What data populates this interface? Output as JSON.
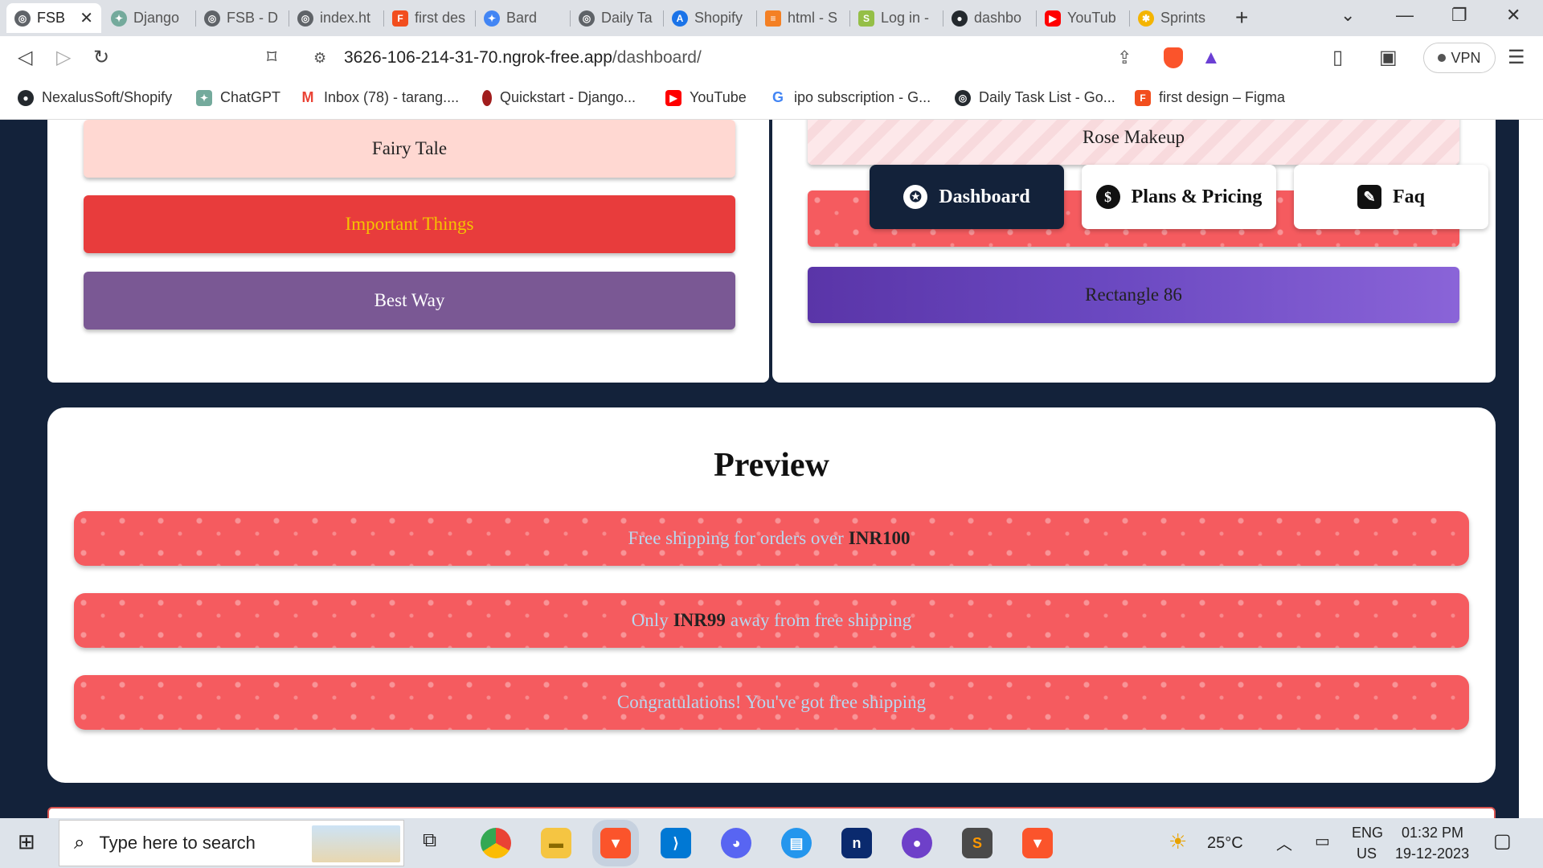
{
  "browser": {
    "tabs": [
      {
        "label": "FSB",
        "color": "#5f6368",
        "active": true
      },
      {
        "label": "Django",
        "color": "#74aa9c"
      },
      {
        "label": "FSB - D",
        "color": "#5f6368"
      },
      {
        "label": "index.ht",
        "color": "#5f6368"
      },
      {
        "label": "first des",
        "color": "#f24e1e"
      },
      {
        "label": "Bard",
        "color": "#4285f4"
      },
      {
        "label": "Daily Ta",
        "color": "#5f6368"
      },
      {
        "label": "Shopify",
        "color": "#1a73e8"
      },
      {
        "label": "html - S",
        "color": "#f48024"
      },
      {
        "label": "Log in -",
        "color": "#95bf47"
      },
      {
        "label": "dashbo",
        "color": "#24292e"
      },
      {
        "label": "YouTub",
        "color": "#ff0000"
      },
      {
        "label": "Sprints",
        "color": "#f4b400"
      }
    ],
    "url_host": "3626-106-214-31-70.ngrok-free.app",
    "url_path": "/dashboard/",
    "vpn_label": "VPN",
    "bookmarks": [
      {
        "label": "NexalusSoft/Shopify",
        "color": "#24292e"
      },
      {
        "label": "ChatGPT",
        "color": "#74aa9c"
      },
      {
        "label": "Inbox (78) - tarang....",
        "color": "#ea4335"
      },
      {
        "label": "Quickstart - Django...",
        "color": "#a11d1d"
      },
      {
        "label": "YouTube",
        "color": "#ff0000"
      },
      {
        "label": "ipo subscription - G...",
        "color": "#4285f4"
      },
      {
        "label": "Daily Task List - Go...",
        "color": "#24292e"
      },
      {
        "label": "first design – Figma",
        "color": "#f24e1e"
      }
    ]
  },
  "left_buttons": [
    {
      "label": "Fairy Tale",
      "bg": "#ffd8d2",
      "fg": "#222"
    },
    {
      "label": "Important Things",
      "bg": "#e83c3c",
      "fg": "#f5c400"
    },
    {
      "label": "Best Way",
      "bg": "#7a5894",
      "fg": "#ffffff"
    }
  ],
  "right_buttons": [
    {
      "label": "Rose Makeup"
    },
    {
      "label": ""
    },
    {
      "label": "Rectangle 86"
    }
  ],
  "nav": {
    "dashboard": "Dashboard",
    "plans": "Plans & Pricing",
    "faq": "Faq"
  },
  "preview": {
    "title": "Preview",
    "bar1": {
      "pre": "Free shipping for orders over",
      "bold": "INR100",
      "post": ""
    },
    "bar2": {
      "pre": "Only",
      "bold": "INR99",
      "post": "away from free shipping"
    },
    "bar3": {
      "text": "Congratulations! You've got free shipping"
    }
  },
  "taskbar": {
    "search_placeholder": "Type here to search",
    "weather": "25°C",
    "lang1": "ENG",
    "lang2": "US",
    "time": "01:32 PM",
    "date": "19-12-2023"
  }
}
